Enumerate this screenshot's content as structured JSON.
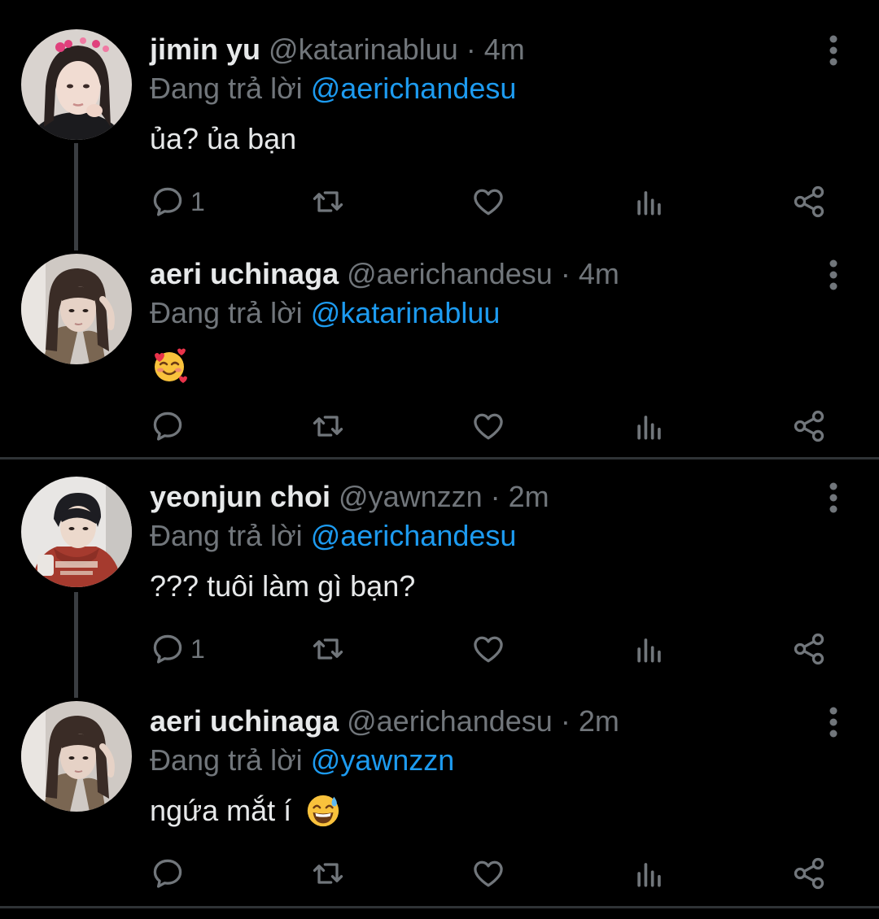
{
  "tweets": [
    {
      "name": "jimin yu",
      "handle": "@katarinabluu",
      "time": "· 4m",
      "reply_prefix": "Đang trả lời",
      "reply_to": "@aerichandesu",
      "text": "ủa? ủa bạn",
      "reply_count": "1"
    },
    {
      "name": "aeri uchinaga",
      "handle": "@aerichandesu",
      "time": "· 4m",
      "reply_prefix": "Đang trả lời",
      "reply_to": "@katarinabluu",
      "text": "",
      "emoji": "🥰",
      "reply_count": ""
    },
    {
      "name": "yeonjun choi",
      "handle": "@yawnzzn",
      "time": "· 2m",
      "reply_prefix": "Đang trả lời",
      "reply_to": "@aerichandesu",
      "text": "??? tuôi làm gì bạn?",
      "reply_count": "1"
    },
    {
      "name": "aeri uchinaga",
      "handle": "@aerichandesu",
      "time": "· 2m",
      "reply_prefix": "Đang trả lời",
      "reply_to": "@yawnzzn",
      "text": "ngứa mắt í",
      "emoji": "😅",
      "reply_count": ""
    }
  ],
  "icons": {
    "reply": "comment-icon",
    "retweet": "retweet-icon",
    "like": "heart-icon",
    "views": "views-icon",
    "share": "share-icon",
    "more": "more-vertical-icon"
  },
  "colors": {
    "background": "#000000",
    "name": "#e7e9ea",
    "secondary": "#71767b",
    "mention": "#1d9bf0",
    "divider": "#2f3336"
  }
}
